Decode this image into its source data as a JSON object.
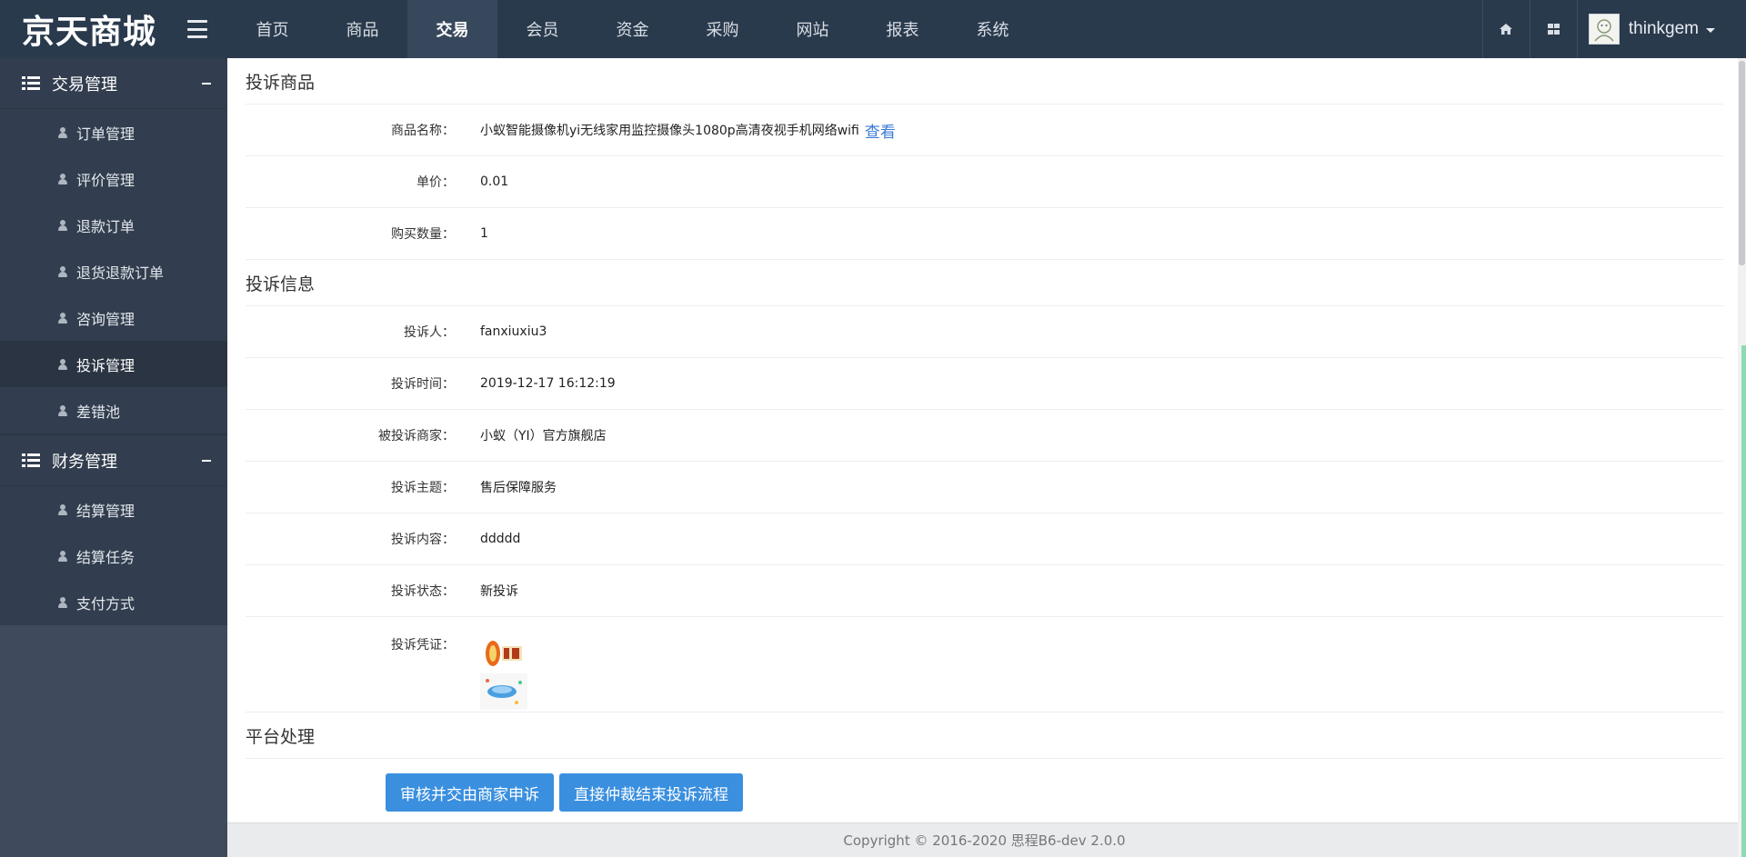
{
  "app": {
    "logo": "京天商城"
  },
  "topnav": {
    "items": [
      "首页",
      "商品",
      "交易",
      "会员",
      "资金",
      "采购",
      "网站",
      "报表",
      "系统"
    ],
    "active_index": 2,
    "user": "thinkgem"
  },
  "sidebar": {
    "groups": [
      {
        "title": "交易管理",
        "items": [
          "订单管理",
          "评价管理",
          "退款订单",
          "退货退款订单",
          "咨询管理",
          "投诉管理",
          "差错池"
        ]
      },
      {
        "title": "财务管理",
        "items": [
          "结算管理",
          "结算任务",
          "支付方式"
        ]
      }
    ],
    "active_item": "投诉管理"
  },
  "product": {
    "section_title": "投诉商品",
    "name_label": "商品名称：",
    "name_value": "小蚁智能摄像机yi无线家用监控摄像头1080p高清夜视手机网络wifi",
    "view_link": "查看",
    "price_label": "单价：",
    "price_value": "0.01",
    "qty_label": "购买数量：",
    "qty_value": "1"
  },
  "complaint": {
    "section_title": "投诉信息",
    "complainant_label": "投诉人：",
    "complainant_value": "fanxiuxiu3",
    "time_label": "投诉时间：",
    "time_value": "2019-12-17 16:12:19",
    "merchant_label": "被投诉商家：",
    "merchant_value": "小蚁（YI）官方旗舰店",
    "subject_label": "投诉主题：",
    "subject_value": "售后保障服务",
    "content_label": "投诉内容：",
    "content_value": "ddddd",
    "status_label": "投诉状态：",
    "status_value": "新投诉",
    "evidence_label": "投诉凭证："
  },
  "platform": {
    "section_title": "平台处理",
    "btn_review": "审核并交由商家申诉",
    "btn_arbitrate": "直接仲裁结束投诉流程"
  },
  "footer": {
    "text": "Copyright © 2016-2020  思程B6-dev  2.0.0"
  }
}
